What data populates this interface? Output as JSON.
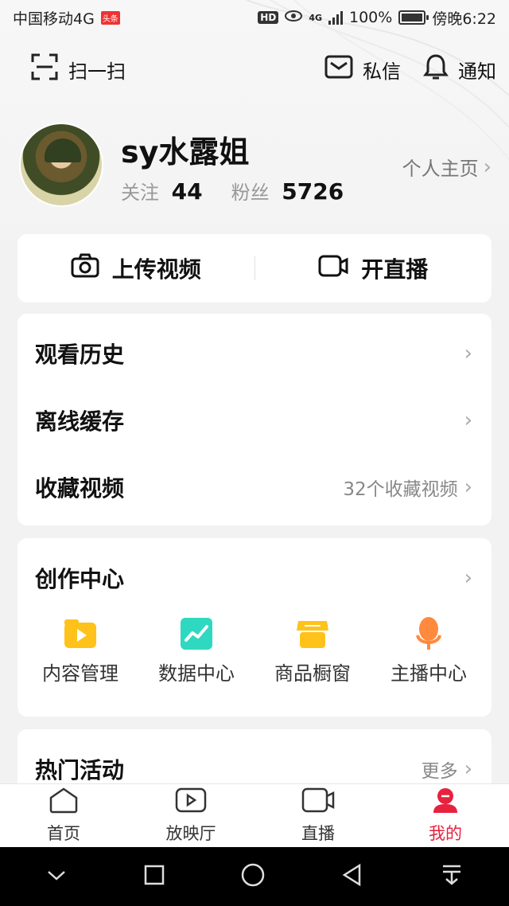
{
  "status_bar": {
    "carrier": "中国移动4G",
    "carrier_badge": "头条",
    "hd": "HD",
    "net": "4G",
    "battery": "100%",
    "time": "傍晚6:22"
  },
  "header": {
    "scan_label": "扫一扫",
    "message_label": "私信",
    "notify_label": "通知"
  },
  "profile": {
    "name": "sy水露姐",
    "following_label": "关注",
    "following_count": "44",
    "followers_label": "粉丝",
    "followers_count": "5726",
    "homepage_label": "个人主页"
  },
  "actions": {
    "upload_label": "上传视频",
    "live_label": "开直播"
  },
  "list": {
    "history": "观看历史",
    "offline": "离线缓存",
    "favorites": "收藏视频",
    "favorites_count": "32个收藏视频"
  },
  "creator": {
    "title": "创作中心",
    "tools": [
      "内容管理",
      "数据中心",
      "商品橱窗",
      "主播中心"
    ]
  },
  "events": {
    "title": "热门活动",
    "more": "更多"
  },
  "bottom_nav": {
    "items": [
      "首页",
      "放映厅",
      "直播",
      "我的"
    ],
    "active": "我的"
  },
  "colors": {
    "accent": "#e8213f",
    "yellow": "#ffc21a",
    "teal": "#2fd8c0",
    "orange": "#ff8a3d"
  }
}
